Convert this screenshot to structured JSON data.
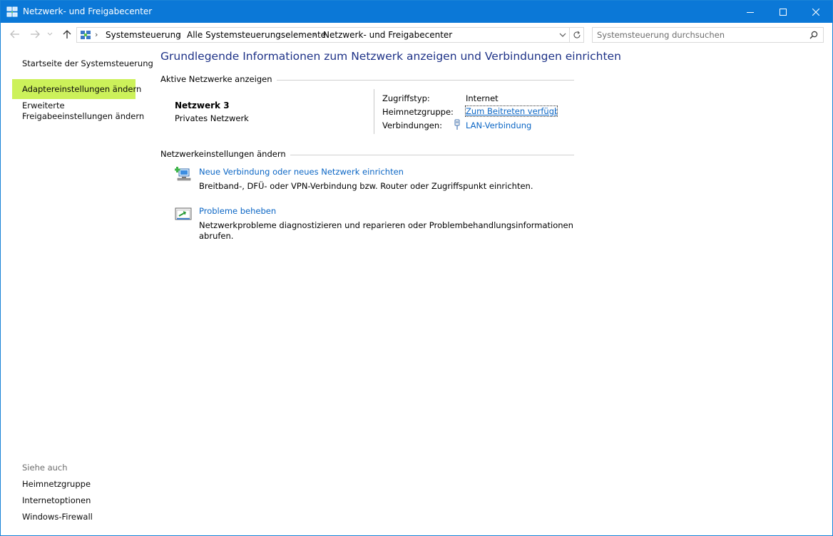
{
  "window": {
    "title": "Netzwerk- und Freigabecenter",
    "accent_color": "#0b78d7"
  },
  "titlebar": {
    "app_icon": "network-center-icon",
    "minimize_icon": "minimize-icon",
    "maximize_icon": "maximize-icon",
    "close_icon": "close-icon"
  },
  "navigation": {
    "back_icon": "back-arrow-icon",
    "forward_icon": "forward-arrow-icon",
    "recent_icon": "chevron-down-icon",
    "up_icon": "up-arrow-icon",
    "breadcrumb": [
      "Systemsteuerung",
      "Alle Systemsteuerungselemente",
      "Netzwerk- und Freigabecenter"
    ],
    "separator": "›",
    "refresh_icon": "refresh-icon",
    "search_placeholder": "Systemsteuerung durchsuchen",
    "search_icon": "search-icon"
  },
  "sidebar": {
    "items": [
      "Startseite der Systemsteuerung",
      "Adaptereinstellungen ändern",
      "Erweiterte",
      "Freigabeeinstellungen ändern"
    ],
    "highlight_color": "#ccf15a",
    "see_also_heading": "Siehe auch",
    "see_also": [
      "Heimnetzgruppe",
      "Internetoptionen",
      "Windows-Firewall"
    ]
  },
  "main": {
    "title": "Grundlegende Informationen zum Netzwerk anzeigen und Verbindungen einrichten",
    "active_networks_heading": "Aktive Netzwerke anzeigen",
    "network": {
      "name": "Netzwerk  3",
      "type": "Privates Netzwerk",
      "access_type_label": "Zugriffstyp:",
      "access_type_value": "Internet",
      "homegroup_label": "Heimnetzgruppe:",
      "homegroup_value": "Zum Beitreten verfügbar",
      "connections_label": "Verbindungen:",
      "connections_value": "LAN-Verbindung",
      "connection_icon": "ethernet-plug-icon"
    },
    "settings_heading": "Netzwerkeinstellungen ändern",
    "tasks": [
      {
        "icon": "new-connection-icon",
        "link": "Neue Verbindung oder neues Netzwerk einrichten",
        "description": "Breitband-, DFÜ- oder VPN-Verbindung bzw. Router oder Zugriffspunkt einrichten."
      },
      {
        "icon": "troubleshoot-icon",
        "link": "Probleme beheben",
        "description_line1": "Netzwerkprobleme diagnostizieren und reparieren oder Problembehandlungsinformationen",
        "description_line2": "abrufen."
      }
    ],
    "link_color": "#0b66c5",
    "title_color": "#1e3287"
  }
}
